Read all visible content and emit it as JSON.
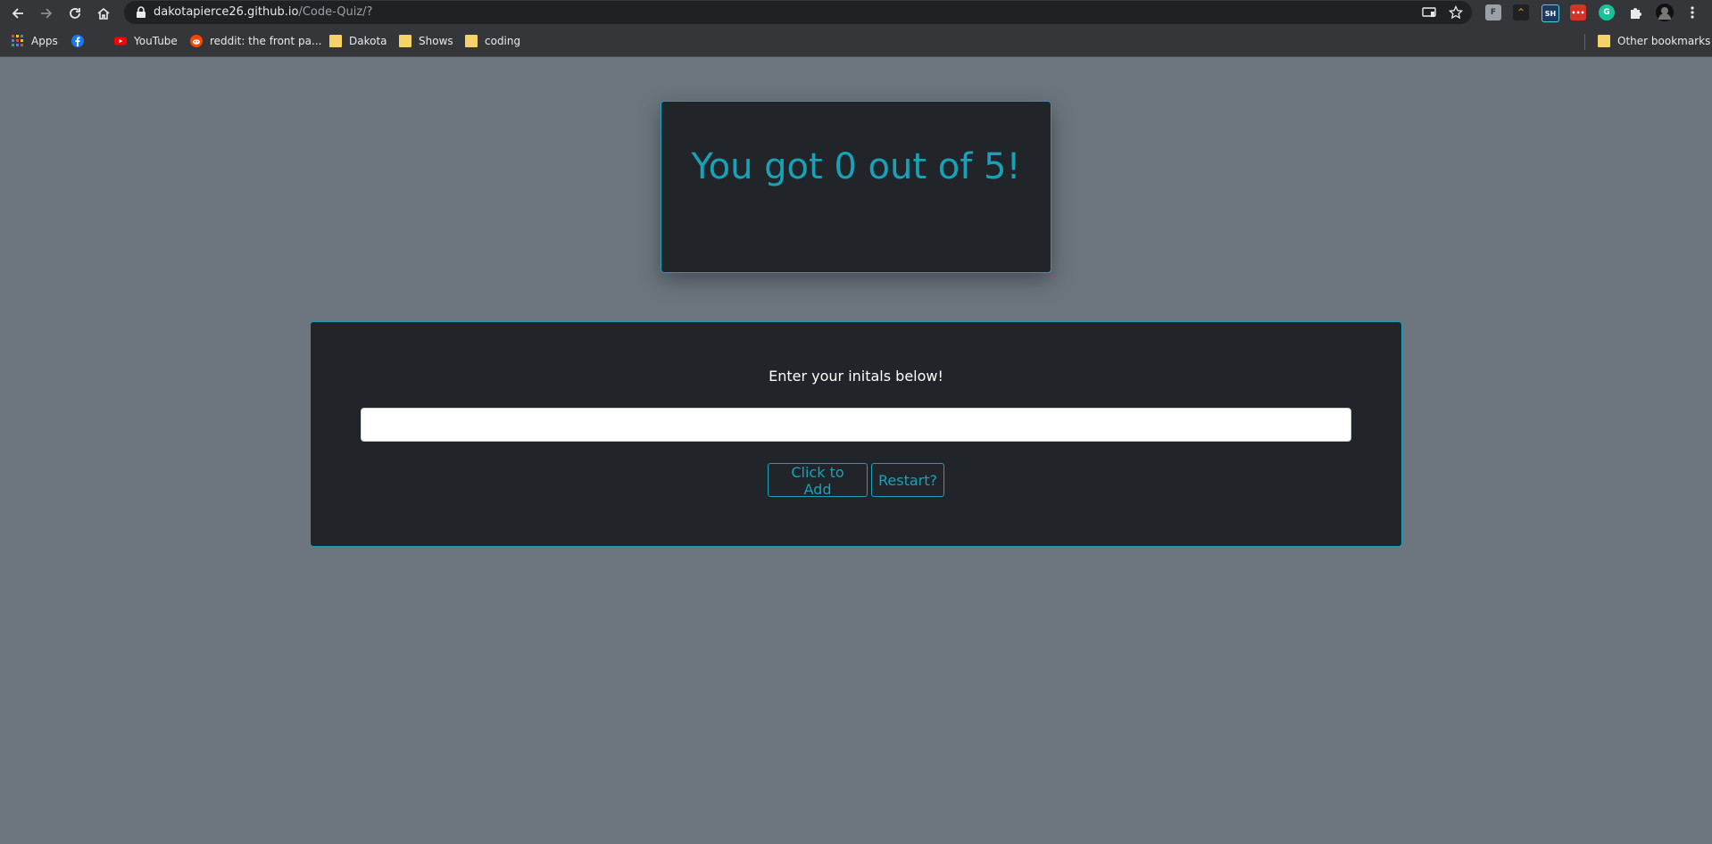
{
  "browser": {
    "url_host": "dakotapierce26.github.io",
    "url_path": "/Code-Quiz/?",
    "bookmarks": [
      {
        "label": "Apps",
        "icon": "apps-grid-icon"
      },
      {
        "label": "",
        "icon": "facebook-icon"
      },
      {
        "label": "YouTube",
        "icon": "youtube-icon"
      },
      {
        "label": "reddit: the front pa...",
        "icon": "reddit-icon"
      },
      {
        "label": "Dakota",
        "icon": "folder-icon"
      },
      {
        "label": "Shows",
        "icon": "folder-icon"
      },
      {
        "label": "coding",
        "icon": "folder-icon"
      }
    ],
    "other_bookmarks": "Other bookmarks",
    "extensions": [
      "F",
      "^",
      "SH",
      "•••",
      "G"
    ]
  },
  "quiz": {
    "result": "You got 0 out of 5!",
    "prompt": "Enter your initals below!",
    "initials_value": "",
    "add_button": "Click to Add",
    "restart_button": "Restart?"
  },
  "colors": {
    "page_bg": "#6c757d",
    "card_bg": "#212529",
    "accent": "#17a2b8"
  }
}
